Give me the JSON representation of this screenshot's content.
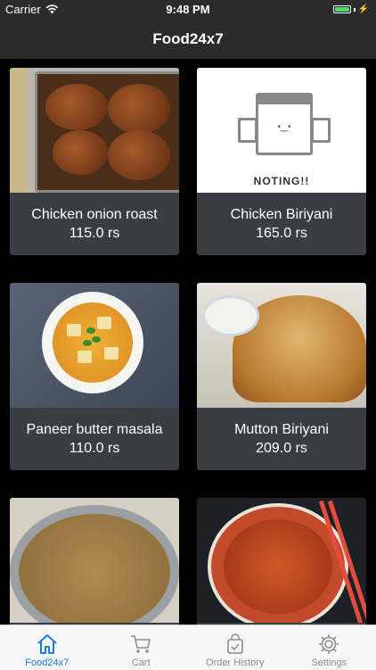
{
  "status_bar": {
    "carrier": "Carrier",
    "time": "9:48 PM"
  },
  "nav": {
    "title": "Food24x7"
  },
  "items": [
    {
      "name": "Chicken onion roast",
      "price": "115.0 rs",
      "icon": "roast-chicken-image"
    },
    {
      "name": "Chicken Biriyani",
      "price": "165.0 rs",
      "icon": "placeholder-image",
      "placeholder_text": "NOTING!!"
    },
    {
      "name": "Paneer butter masala",
      "price": "110.0 rs",
      "icon": "paneer-image"
    },
    {
      "name": "Mutton Biriyani",
      "price": "209.0 rs",
      "icon": "biriyani-image"
    },
    {
      "name": "",
      "price": "",
      "icon": "curry-image"
    },
    {
      "name": "",
      "price": "",
      "icon": "chilli-chicken-image"
    }
  ],
  "tabs": [
    {
      "label": "Food24x7",
      "icon": "home-icon",
      "active": true
    },
    {
      "label": "Cart",
      "icon": "cart-icon",
      "active": false
    },
    {
      "label": "Order History",
      "icon": "bag-icon",
      "active": false
    },
    {
      "label": "Settings",
      "icon": "gear-icon",
      "active": false
    }
  ],
  "colors": {
    "accent": "#1a7ee0",
    "card_bg": "#3a3d43",
    "nav_bg": "#2b2b2b",
    "battery": "#4cd964"
  }
}
